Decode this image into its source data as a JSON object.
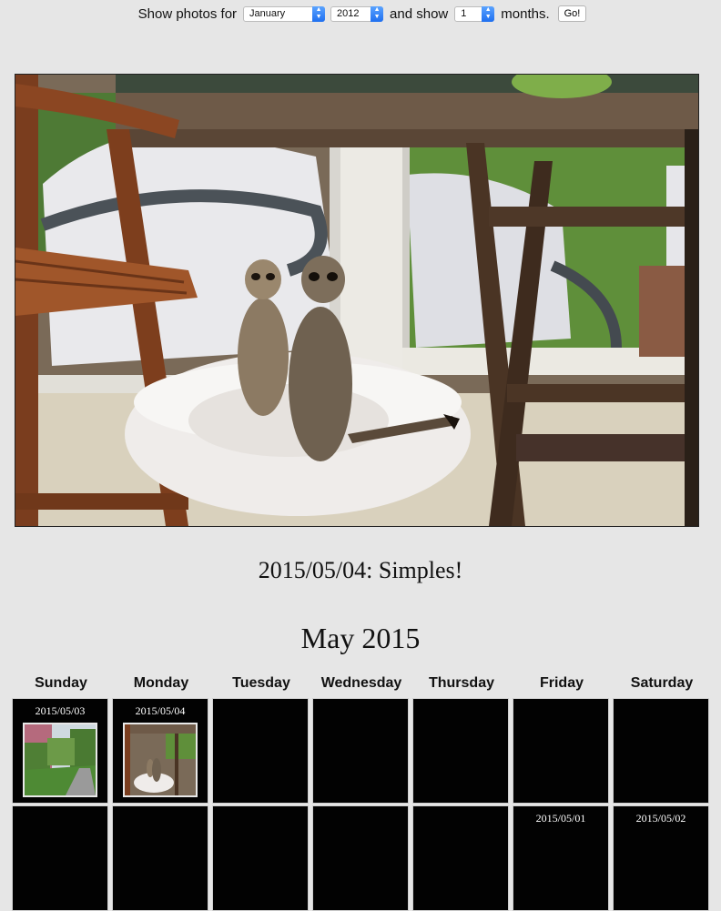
{
  "controls": {
    "show_photos_label": "Show photos for",
    "month": "January",
    "year": "2012",
    "and_show_label": "and show",
    "count": "1",
    "months_label": "months.",
    "go_label": "Go!"
  },
  "photo": {
    "caption": "2015/05/04: Simples!"
  },
  "calendar": {
    "title": "May 2015",
    "weekdays": [
      "Sunday",
      "Monday",
      "Tuesday",
      "Wednesday",
      "Thursday",
      "Friday",
      "Saturday"
    ],
    "row1": [
      "2015/05/03",
      "2015/05/04",
      "",
      "",
      "",
      "",
      ""
    ],
    "row2": [
      "",
      "",
      "",
      "",
      "",
      "2015/05/01",
      "2015/05/02"
    ]
  }
}
